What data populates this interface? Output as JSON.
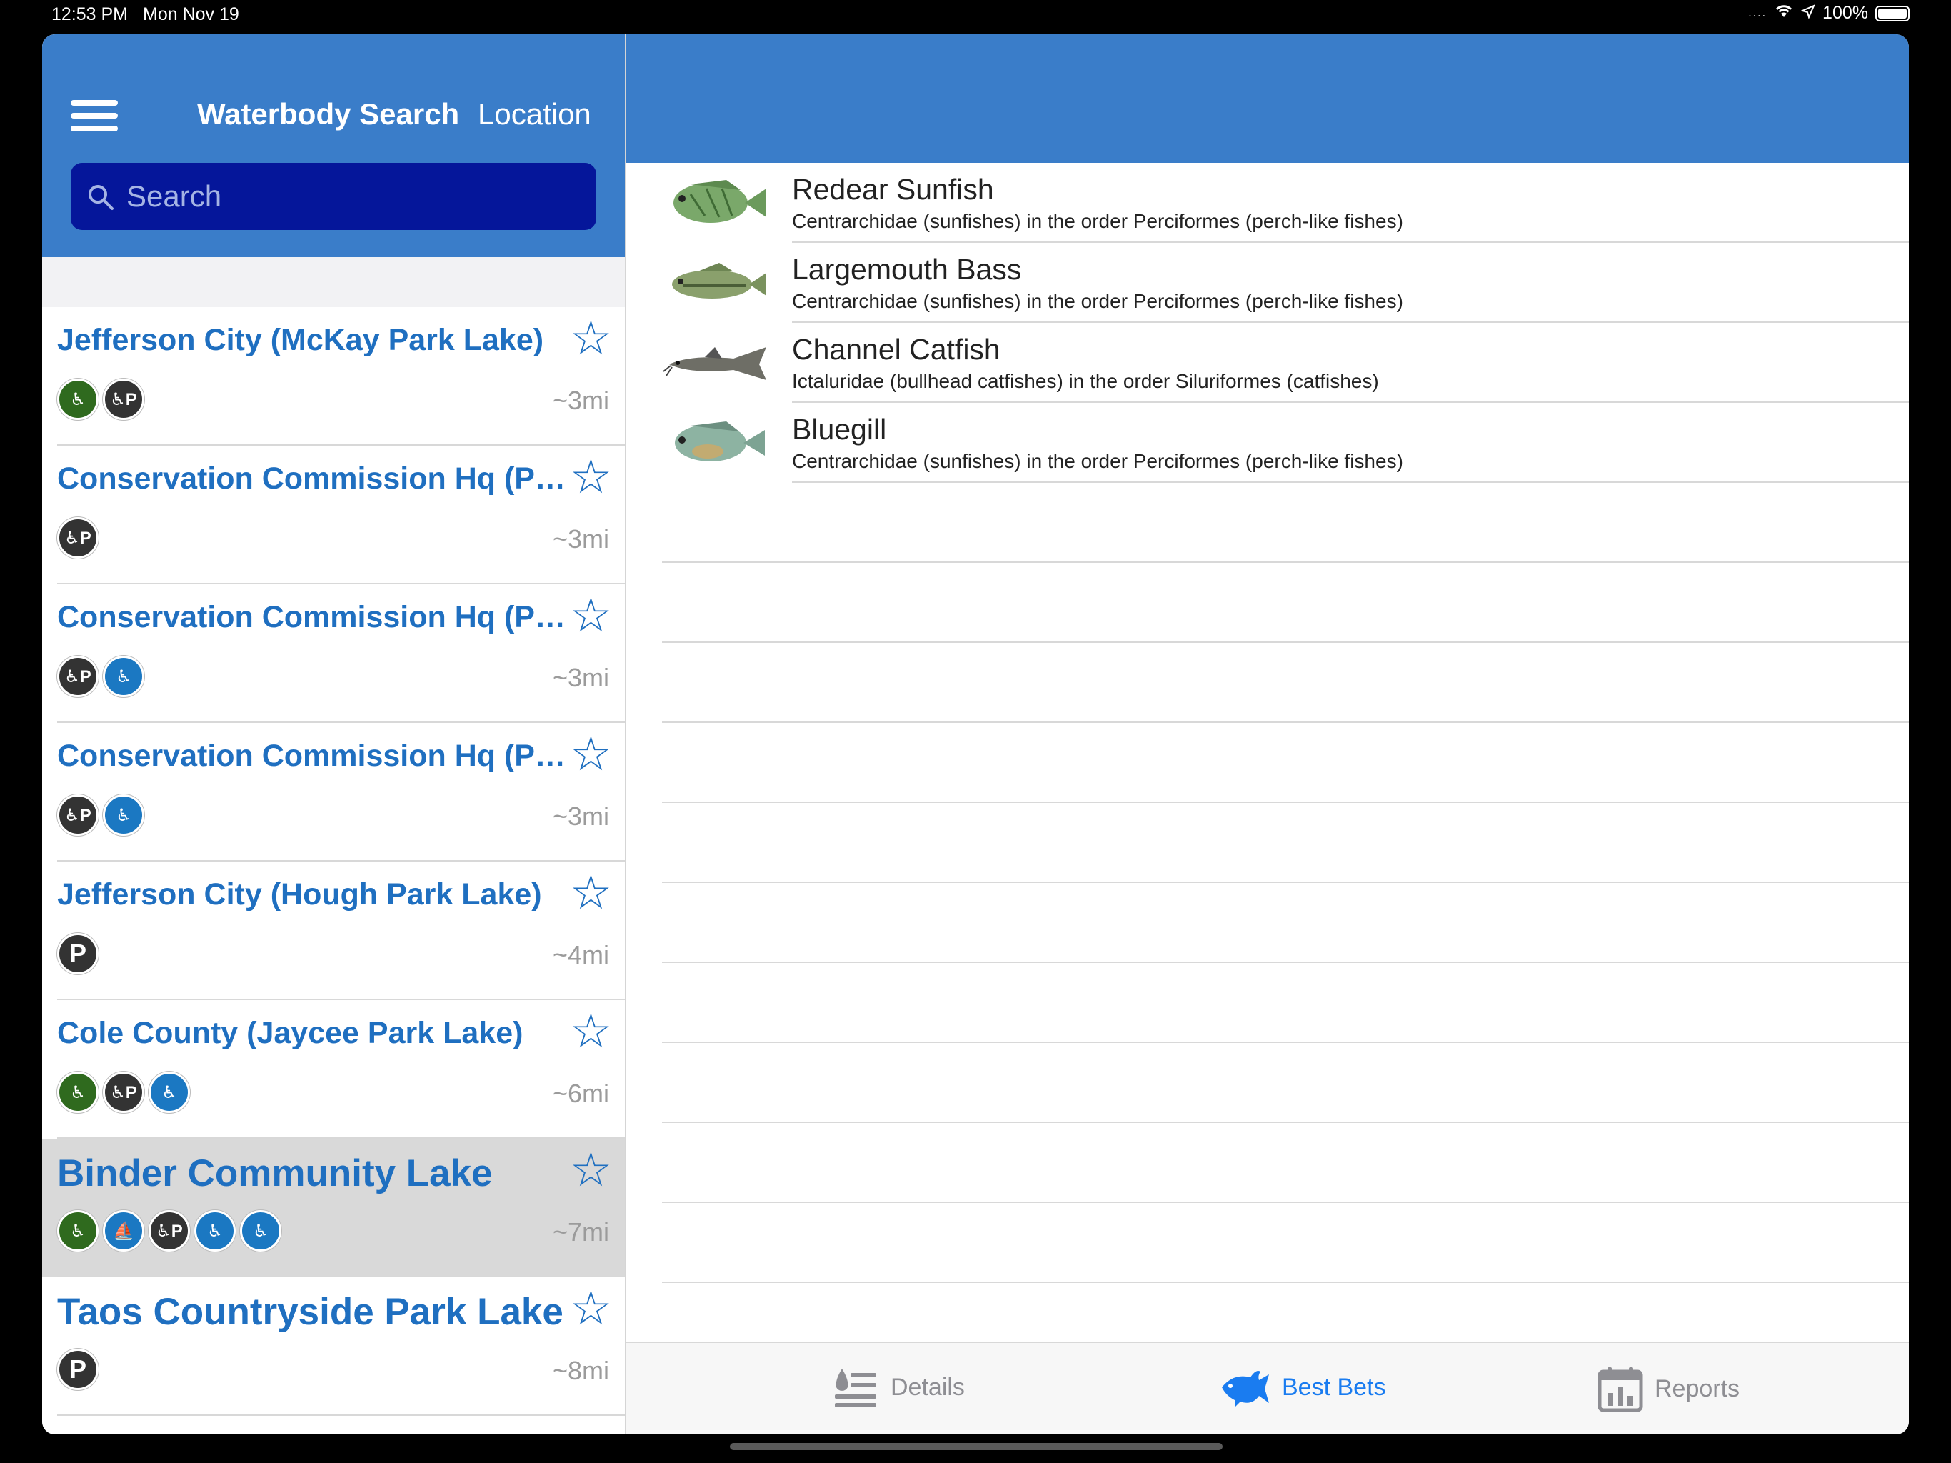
{
  "status_bar": {
    "time": "12:53 PM",
    "date": "Mon Nov 19",
    "battery": "100%"
  },
  "left_header": {
    "title": "Waterbody Search",
    "subtitle": "Location",
    "menu_icon": "hamburger-menu-icon",
    "search_icon": "search-icon",
    "search_placeholder": "Search",
    "colors": {
      "header": "#3a7dc9",
      "search_bg": "#05169a",
      "link": "#1f6fc0"
    }
  },
  "waterbodies": [
    {
      "name": "Jefferson City (McKay Park Lake)",
      "distance": "~3mi",
      "amenities": [
        "restroom-accessible",
        "accessible-parking"
      ],
      "favorite": false
    },
    {
      "name": "Conservation Commission Hq (Po...",
      "distance": "~3mi",
      "amenities": [
        "accessible-parking"
      ],
      "favorite": false
    },
    {
      "name": "Conservation Commission Hq (Po...",
      "distance": "~3mi",
      "amenities": [
        "accessible-parking",
        "accessible-fishing"
      ],
      "favorite": false
    },
    {
      "name": "Conservation Commission Hq (Po...",
      "distance": "~3mi",
      "amenities": [
        "accessible-parking",
        "accessible-fishing"
      ],
      "favorite": false
    },
    {
      "name": "Jefferson City (Hough Park Lake)",
      "distance": "~4mi",
      "amenities": [
        "parking"
      ],
      "favorite": false
    },
    {
      "name": "Cole County (Jaycee Park Lake)",
      "distance": "~6mi",
      "amenities": [
        "restroom-accessible",
        "accessible-parking",
        "accessible-fishing"
      ],
      "favorite": false
    },
    {
      "name": "Binder Community Lake",
      "distance": "~7mi",
      "amenities": [
        "restroom-accessible",
        "boat-ramp",
        "accessible-parking",
        "accessible-fishing",
        "accessible-boat"
      ],
      "favorite": false,
      "selected": true
    },
    {
      "name": "Taos Countryside Park Lake",
      "distance": "~8mi",
      "amenities": [
        "parking"
      ],
      "favorite": false
    }
  ],
  "fish": [
    {
      "name": "Redear Sunfish",
      "family": "Centrarchidae (sunfishes) in the order Perciformes (perch-like fishes)",
      "icon": "sunfish-image"
    },
    {
      "name": "Largemouth Bass",
      "family": "Centrarchidae (sunfishes) in the order Perciformes (perch-like fishes)",
      "icon": "bass-image"
    },
    {
      "name": "Channel Catfish",
      "family": "Ictaluridae (bullhead catfishes) in the order Siluriformes (catfishes)",
      "icon": "catfish-image"
    },
    {
      "name": "Bluegill",
      "family": "Centrarchidae (sunfishes) in the order Perciformes (perch-like fishes)",
      "icon": "bluegill-image"
    }
  ],
  "tabs": [
    {
      "label": "Details",
      "icon": "details-list-icon",
      "active": false
    },
    {
      "label": "Best Bets",
      "icon": "fish-icon",
      "active": true
    },
    {
      "label": "Reports",
      "icon": "calendar-chart-icon",
      "active": false
    }
  ]
}
